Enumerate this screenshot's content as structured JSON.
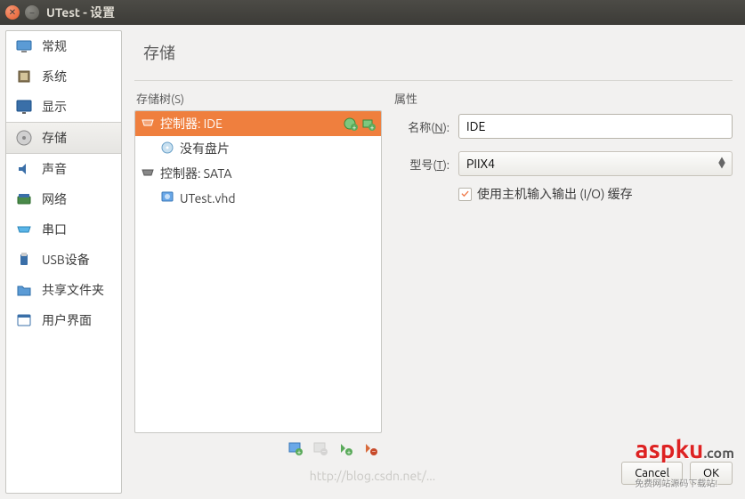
{
  "window": {
    "title": "UTest - 设置"
  },
  "sidebar": {
    "items": [
      {
        "label": "常规",
        "icon": "monitor"
      },
      {
        "label": "系统",
        "icon": "chip"
      },
      {
        "label": "显示",
        "icon": "display"
      },
      {
        "label": "存储",
        "icon": "disk"
      },
      {
        "label": "声音",
        "icon": "audio"
      },
      {
        "label": "网络",
        "icon": "network"
      },
      {
        "label": "串口",
        "icon": "serial"
      },
      {
        "label": "USB设备",
        "icon": "usb"
      },
      {
        "label": "共享文件夹",
        "icon": "folder"
      },
      {
        "label": "用户界面",
        "icon": "ui"
      }
    ],
    "selected": 3
  },
  "header": {
    "title": "存储"
  },
  "storage": {
    "tree_label": "存储树(S)",
    "controllers": [
      {
        "name": "控制器: IDE",
        "selected": true,
        "children": [
          {
            "name": "没有盘片",
            "icon": "cd"
          }
        ]
      },
      {
        "name": "控制器: SATA",
        "selected": false,
        "children": [
          {
            "name": "UTest.vhd",
            "icon": "hdd"
          }
        ]
      }
    ]
  },
  "props": {
    "panel_label": "属性",
    "name_label": "名称(N):",
    "name_value": "IDE",
    "model_label": "型号(T):",
    "model_value": "PIIX4",
    "io_cache_label": "使用主机输入输出 (I/O) 缓存",
    "io_cache_checked": true
  },
  "buttons": {
    "cancel": "Cancel",
    "ok": "OK"
  },
  "watermark": {
    "brand": "aspku",
    "suffix": ".com",
    "tagline": "免费网站源码下载站!",
    "blog": "http://blog.csdn.net/..."
  }
}
